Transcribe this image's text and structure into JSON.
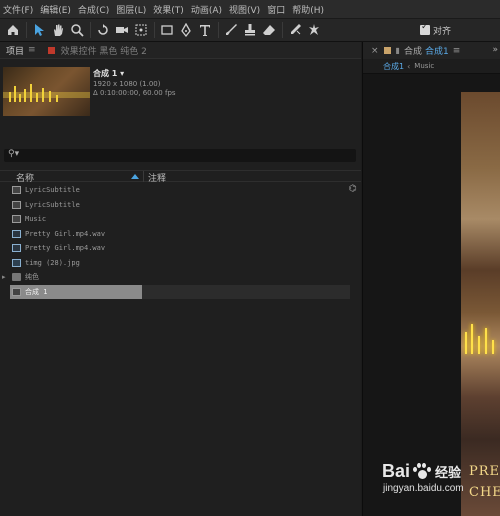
{
  "menu": [
    "文件(F)",
    "编辑(E)",
    "合成(C)",
    "图层(L)",
    "效果(T)",
    "动画(A)",
    "视图(V)",
    "窗口",
    "帮助(H)"
  ],
  "toolbar": {
    "tools": [
      "home-icon",
      "selection-tool-icon",
      "hand-tool-icon",
      "zoom-tool-icon",
      "rotate-tool-icon",
      "camera-tool-icon",
      "pan-behind-tool-icon",
      "rectangle-tool-icon",
      "pen-tool-icon",
      "type-tool-icon",
      "brush-tool-icon",
      "clone-stamp-tool-icon",
      "eraser-tool-icon",
      "roto-brush-tool-icon",
      "puppet-tool-icon"
    ],
    "snap_label": "对齐",
    "snap_checked": true
  },
  "project_panel": {
    "tab_project": "项目",
    "tab_menu": "≡",
    "tab_effects": "效果控件 黑色 纯色 2",
    "selected_item": {
      "name": "合成 1",
      "dimensions": "1920 x 1080 (1.00)",
      "duration": "Δ 0:10:00:00, 60.00 fps"
    },
    "search_placeholder": "",
    "columns": {
      "name": "名称",
      "comment": "注释"
    },
    "items": [
      {
        "type": "comp",
        "name": "LyricSubtitle"
      },
      {
        "type": "comp",
        "name": "LyricSubtitle"
      },
      {
        "type": "comp",
        "name": "Music"
      },
      {
        "type": "audio",
        "name": "Pretty Girl.mp4.wav"
      },
      {
        "type": "audio",
        "name": "Pretty Girl.mp4.wav"
      },
      {
        "type": "image",
        "name": "timg (28).jpg"
      },
      {
        "type": "folder",
        "name": "纯色"
      },
      {
        "type": "comp",
        "name": "合成 1",
        "selected": true
      }
    ]
  },
  "comp_panel": {
    "close": "×",
    "lock": "🔒",
    "label": "合成",
    "active_tab": "合成1",
    "tab_close": "≡",
    "more": "»",
    "breadcrumb": [
      "合成1",
      "Music"
    ],
    "overlay_text": [
      "PRET",
      "CHE"
    ]
  },
  "watermark": {
    "brand_left": "Bai",
    "brand_right": "经验",
    "url": "jingyan.baidu.com"
  },
  "colors": {
    "accent_blue": "#5aa9e6",
    "tab_red": "#c0392b",
    "tab_tan": "#c9a36a"
  }
}
